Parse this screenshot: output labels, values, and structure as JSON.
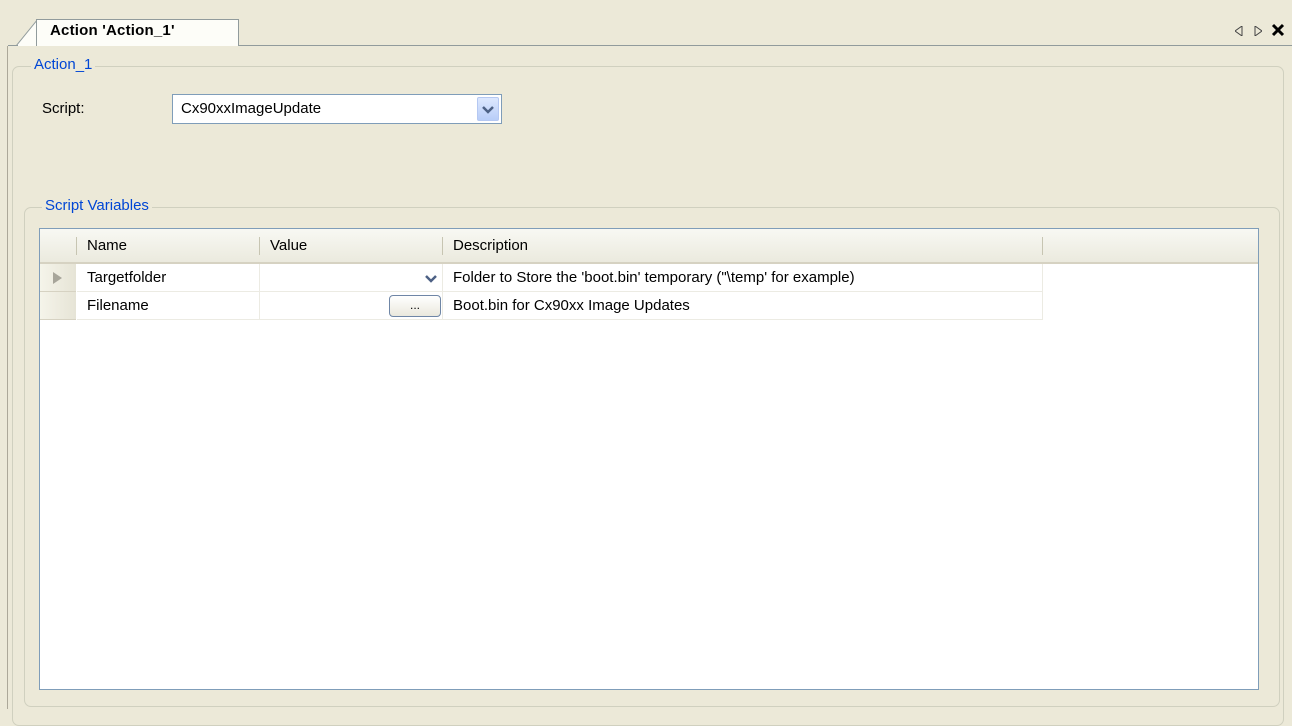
{
  "tab": {
    "label": "Action 'Action_1'"
  },
  "window_controls": {
    "prev_icon": "triangle-left",
    "next_icon": "triangle-right",
    "close_icon": "close-x"
  },
  "action_group": {
    "title": "Action_1",
    "script_label": "Script:",
    "script_value": "Cx90xxImageUpdate"
  },
  "variables_group": {
    "title": "Script Variables",
    "columns": [
      "Name",
      "Value",
      "Description"
    ],
    "rows": [
      {
        "name": "Targetfolder",
        "value": "",
        "editor": "dropdown",
        "description": "Folder to Store the 'boot.bin' temporary (\"\\temp' for example)",
        "current": true
      },
      {
        "name": "Filename",
        "value": "",
        "editor": "ellipsis",
        "ellipsis_label": "...",
        "description": "Boot.bin for Cx90xx Image Updates",
        "current": false
      }
    ]
  },
  "colors": {
    "accent": "#0046d5",
    "background": "#ece9d8",
    "border": "#7f9db9"
  }
}
